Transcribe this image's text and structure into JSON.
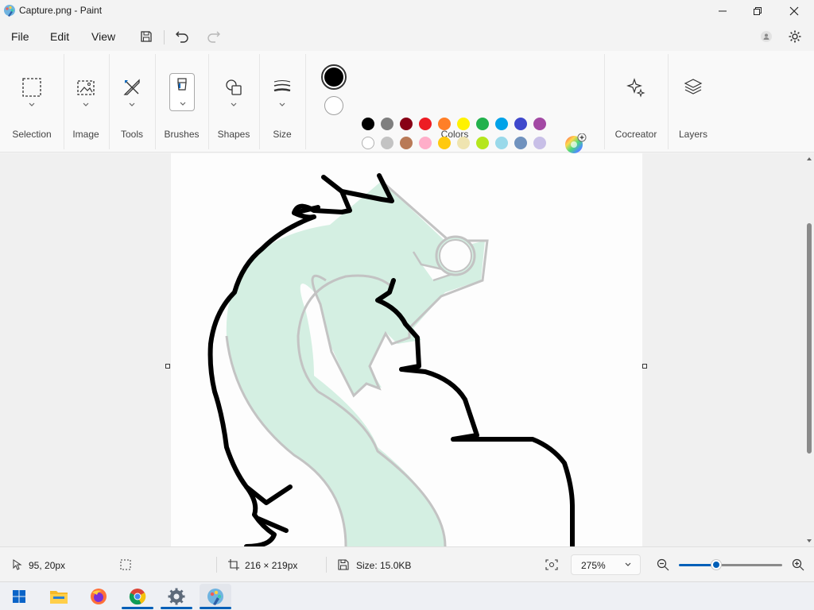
{
  "window": {
    "title": "Capture.png - Paint"
  },
  "menu": {
    "file": "File",
    "edit": "Edit",
    "view": "View"
  },
  "ribbon": {
    "selection": "Selection",
    "image": "Image",
    "tools": "Tools",
    "brushes": "Brushes",
    "shapes": "Shapes",
    "size": "Size",
    "colors": "Colors",
    "cocreator": "Cocreator",
    "layers": "Layers"
  },
  "colors": {
    "primary": "#000000",
    "secondary": "#ffffff",
    "row1": [
      "#000000",
      "#7f7f7f",
      "#880015",
      "#ed1c24",
      "#ff7f27",
      "#fff200",
      "#22b14c",
      "#00a2e8",
      "#3f48cc",
      "#a349a4"
    ],
    "row2": [
      "#ffffff",
      "#c3c3c3",
      "#b97a57",
      "#ffaec9",
      "#ffc90e",
      "#efe4b0",
      "#b5e61d",
      "#99d9ea",
      "#7092be",
      "#c8bfe7"
    ],
    "row3_count": 10
  },
  "status": {
    "cursor_pos": "95, 20px",
    "canvas_size": "216 × 219px",
    "file_size": "Size: 15.0KB",
    "zoom": "275%"
  },
  "zoom_slider_fraction": 0.36,
  "taskbar": [
    "windows-start",
    "file-explorer",
    "firefox",
    "chrome",
    "settings",
    "paint"
  ]
}
